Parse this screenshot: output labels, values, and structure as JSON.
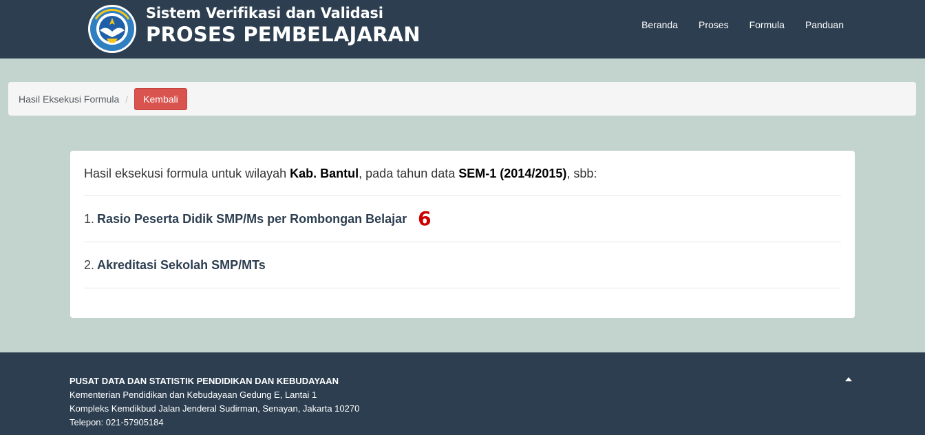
{
  "header": {
    "title_line1": "Sistem Verifikasi dan Validasi",
    "title_line2": "PROSES PEMBELAJARAN",
    "nav": [
      "Beranda",
      "Proses",
      "Formula",
      "Panduan"
    ]
  },
  "breadcrumb": {
    "link": "Hasil Eksekusi Formula",
    "separator": "/",
    "back_button": "Kembali"
  },
  "result": {
    "intro_prefix": "Hasil eksekusi formula untuk wilayah ",
    "region": "Kab. Bantul",
    "intro_middle": ", pada tahun data ",
    "period": "SEM-1 (2014/2015)",
    "intro_suffix": ", sbb:",
    "items": [
      {
        "number": "1.",
        "title": "Rasio Peserta Didik SMP/Ms per Rombongan Belajar",
        "value": "6"
      },
      {
        "number": "2.",
        "title": "Akreditasi Sekolah SMP/MTs",
        "value": ""
      }
    ]
  },
  "footer": {
    "org": "PUSAT DATA DAN STATISTIK PENDIDIKAN DAN KEBUDAYAAN",
    "address1": "Kementerian Pendidikan dan Kebudayaan Gedung E, Lantai 1",
    "address2": "Kompleks Kemdikbud Jalan Jenderal Sudirman, Senayan, Jakarta 10270",
    "phone": "Telepon: 021-57905184"
  },
  "colors": {
    "header_bg": "#2c3e50",
    "page_bg": "#c3d4ce",
    "danger": "#d9534f",
    "value_red": "#cc0000"
  },
  "icons": {
    "logo": "tut-wuri-handayani-logo",
    "back_to_top": "caret-up-icon"
  }
}
